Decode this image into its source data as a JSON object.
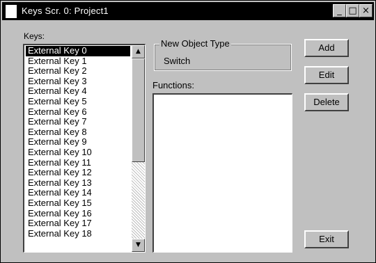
{
  "window": {
    "title": "Keys Scr. 0: Project1"
  },
  "titlebar_buttons": {
    "minimize": "_",
    "maximize": "□",
    "close": "×"
  },
  "keys": {
    "label": "Keys:",
    "selected_index": 0,
    "items": [
      "External Key 0",
      "External Key 1",
      "External Key 2",
      "External Key 3",
      "External Key 4",
      "External Key 5",
      "External Key 6",
      "External Key 7",
      "External Key 8",
      "External Key 9",
      "External Key 10",
      "External Key 11",
      "External Key 12",
      "External Key 13",
      "External Key 14",
      "External Key 15",
      "External Key 16",
      "External Key 17",
      "External Key 18"
    ]
  },
  "scrollbar": {
    "up_icon": "▲",
    "down_icon": "▼"
  },
  "new_object_type": {
    "label": "New Object Type",
    "value": "Switch"
  },
  "functions": {
    "label": "Functions:"
  },
  "buttons": {
    "add": "Add",
    "edit": "Edit",
    "delete": "Delete",
    "exit": "Exit"
  }
}
